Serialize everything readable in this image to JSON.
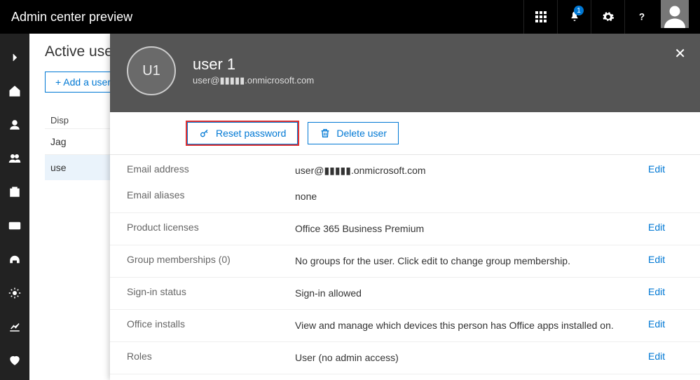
{
  "topbar": {
    "title": "Admin center preview",
    "notification_count": "1"
  },
  "page": {
    "title": "Active users",
    "add_user_label": "+  Add a user",
    "column_header": "Disp",
    "rows": [
      "Jag",
      "use"
    ]
  },
  "panel": {
    "user_initials": "U1",
    "user_name": "user 1",
    "user_email_masked": "user@▮▮▮▮▮.onmicrosoft.com",
    "actions": {
      "reset_password": "Reset password",
      "delete_user": "Delete user"
    },
    "details": {
      "email_address": {
        "label": "Email address",
        "value": "user@▮▮▮▮▮.onmicrosoft.com"
      },
      "email_aliases": {
        "label": "Email aliases",
        "value": "none"
      },
      "product_licenses": {
        "label": "Product licenses",
        "value": "Office 365 Business Premium"
      },
      "group_memberships": {
        "label": "Group memberships (0)",
        "value": "No groups for the user. Click edit to change group membership."
      },
      "signin_status": {
        "label": "Sign-in status",
        "value": "Sign-in allowed"
      },
      "office_installs": {
        "label": "Office installs",
        "value": "View and manage which devices this person has Office apps installed on."
      },
      "roles": {
        "label": "Roles",
        "value": "User (no admin access)"
      }
    },
    "edit_label": "Edit"
  }
}
